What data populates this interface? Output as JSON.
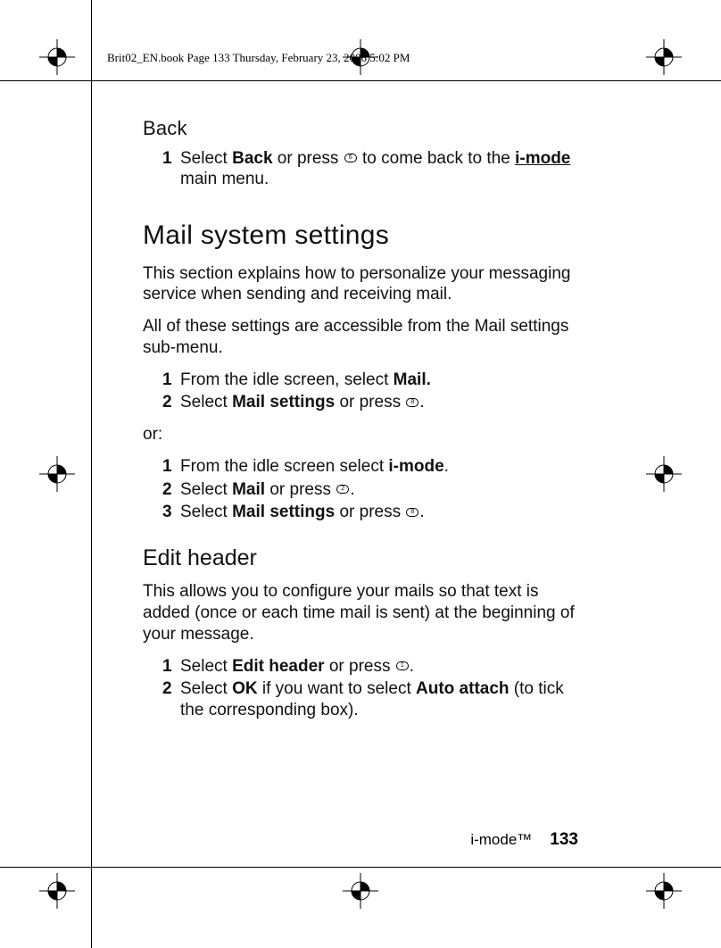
{
  "header": {
    "runhead": "Brit02_EN.book  Page 133  Thursday, February 23, 2006  5:02 PM"
  },
  "sections": {
    "back": {
      "title": "Back",
      "steps": [
        {
          "num": "1",
          "pre": "Select ",
          "bold1": "Back",
          "mid": " or press ",
          "post": " to come back to the ",
          "underlined": "i-mode",
          "tail": " main menu."
        }
      ]
    },
    "mail_settings": {
      "title": "Mail system settings",
      "intro1": "This section explains how to personalize your messaging service when sending and receiving mail.",
      "intro2": "All of these settings are accessible from the Mail settings sub-menu.",
      "stepsA": [
        {
          "num": "1",
          "text_pre": "From the idle screen, select ",
          "bold": "Mail.",
          "text_post": ""
        },
        {
          "num": "2",
          "text_pre": "Select ",
          "bold": "Mail settings",
          "text_mid": " or press ",
          "text_post": "."
        }
      ],
      "or_label": "or:",
      "stepsB": [
        {
          "num": "1",
          "text_pre": "From the idle screen select ",
          "bold": "i-mode",
          "text_post": "."
        },
        {
          "num": "2",
          "text_pre": "Select ",
          "bold": "Mail",
          "text_mid": " or press ",
          "text_post": "."
        },
        {
          "num": "3",
          "text_pre": "Select ",
          "bold": "Mail settings",
          "text_mid": " or press ",
          "text_post": "."
        }
      ]
    },
    "edit_header": {
      "title": "Edit header",
      "intro": "This allows you to configure your mails so that text is added (once or each time mail is sent) at the beginning of your message.",
      "steps": [
        {
          "num": "1",
          "text_pre": "Select ",
          "bold": "Edit header",
          "text_mid": " or press ",
          "text_post": "."
        },
        {
          "num": "2",
          "text_pre": "Select ",
          "bold": "OK",
          "text_mid": " if you want to select ",
          "bold2": "Auto attach",
          "text_post": " (to tick the corresponding box)."
        }
      ]
    }
  },
  "footer": {
    "section_label": "i-mode™",
    "page_number": "133"
  }
}
